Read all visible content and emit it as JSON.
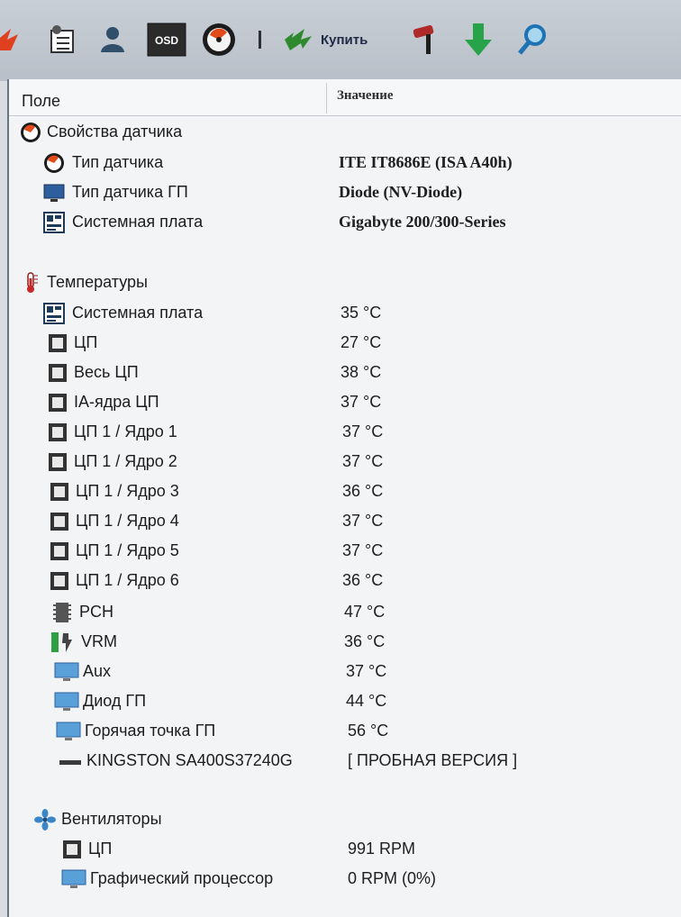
{
  "toolbar": {
    "buttons": [
      {
        "name": "report-icon"
      },
      {
        "name": "user-icon"
      },
      {
        "name": "osd-icon",
        "text": "OSD"
      },
      {
        "name": "sensor-icon"
      },
      {
        "name": "buy-icon",
        "label": "Купить"
      },
      {
        "name": "tools-icon"
      },
      {
        "name": "download-icon"
      },
      {
        "name": "search-icon"
      }
    ]
  },
  "header": {
    "field": "Поле",
    "value": "Значение"
  },
  "sections": {
    "sensor": {
      "title": "Свойства датчика",
      "rows": [
        {
          "label": "Тип датчика",
          "value": "ITE IT8686E  (ISA A40h)"
        },
        {
          "label": "Тип датчика ГП",
          "value": "Diode  (NV-Diode)"
        },
        {
          "label": "Системная плата",
          "value": "Gigabyte 200/300-Series"
        }
      ]
    },
    "temps": {
      "title": "Температуры",
      "rows": [
        {
          "label": "Системная плата",
          "value": "35 °C"
        },
        {
          "label": "ЦП",
          "value": "27 °C"
        },
        {
          "label": "Весь ЦП",
          "value": "38 °C"
        },
        {
          "label": "IA-ядра ЦП",
          "value": "37 °C"
        },
        {
          "label": "ЦП 1 / Ядро 1",
          "value": "37 °C"
        },
        {
          "label": "ЦП 1 / Ядро 2",
          "value": "37 °C"
        },
        {
          "label": "ЦП 1 / Ядро 3",
          "value": "36 °C"
        },
        {
          "label": "ЦП 1 / Ядро 4",
          "value": "37 °C"
        },
        {
          "label": "ЦП 1 / Ядро 5",
          "value": "37 °C"
        },
        {
          "label": "ЦП 1 / Ядро 6",
          "value": "36 °C"
        },
        {
          "label": "PCH",
          "value": "47 °C"
        },
        {
          "label": "VRM",
          "value": "36 °C"
        },
        {
          "label": "Aux",
          "value": "37 °C"
        },
        {
          "label": "Диод ГП",
          "value": "44 °C"
        },
        {
          "label": "Горячая точка ГП",
          "value": "56 °C"
        },
        {
          "label": "KINGSTON SA400S37240G",
          "value": "[ ПРОБНАЯ ВЕРСИЯ ]"
        }
      ]
    },
    "fans": {
      "title": "Вентиляторы",
      "rows": [
        {
          "label": "ЦП",
          "value": "991 RPM"
        },
        {
          "label": "Графический процессор",
          "value": "0 RPM  (0%)"
        }
      ]
    }
  },
  "colors": {
    "accent": "#2d5f9e",
    "value_muted": "#6b6f75"
  }
}
